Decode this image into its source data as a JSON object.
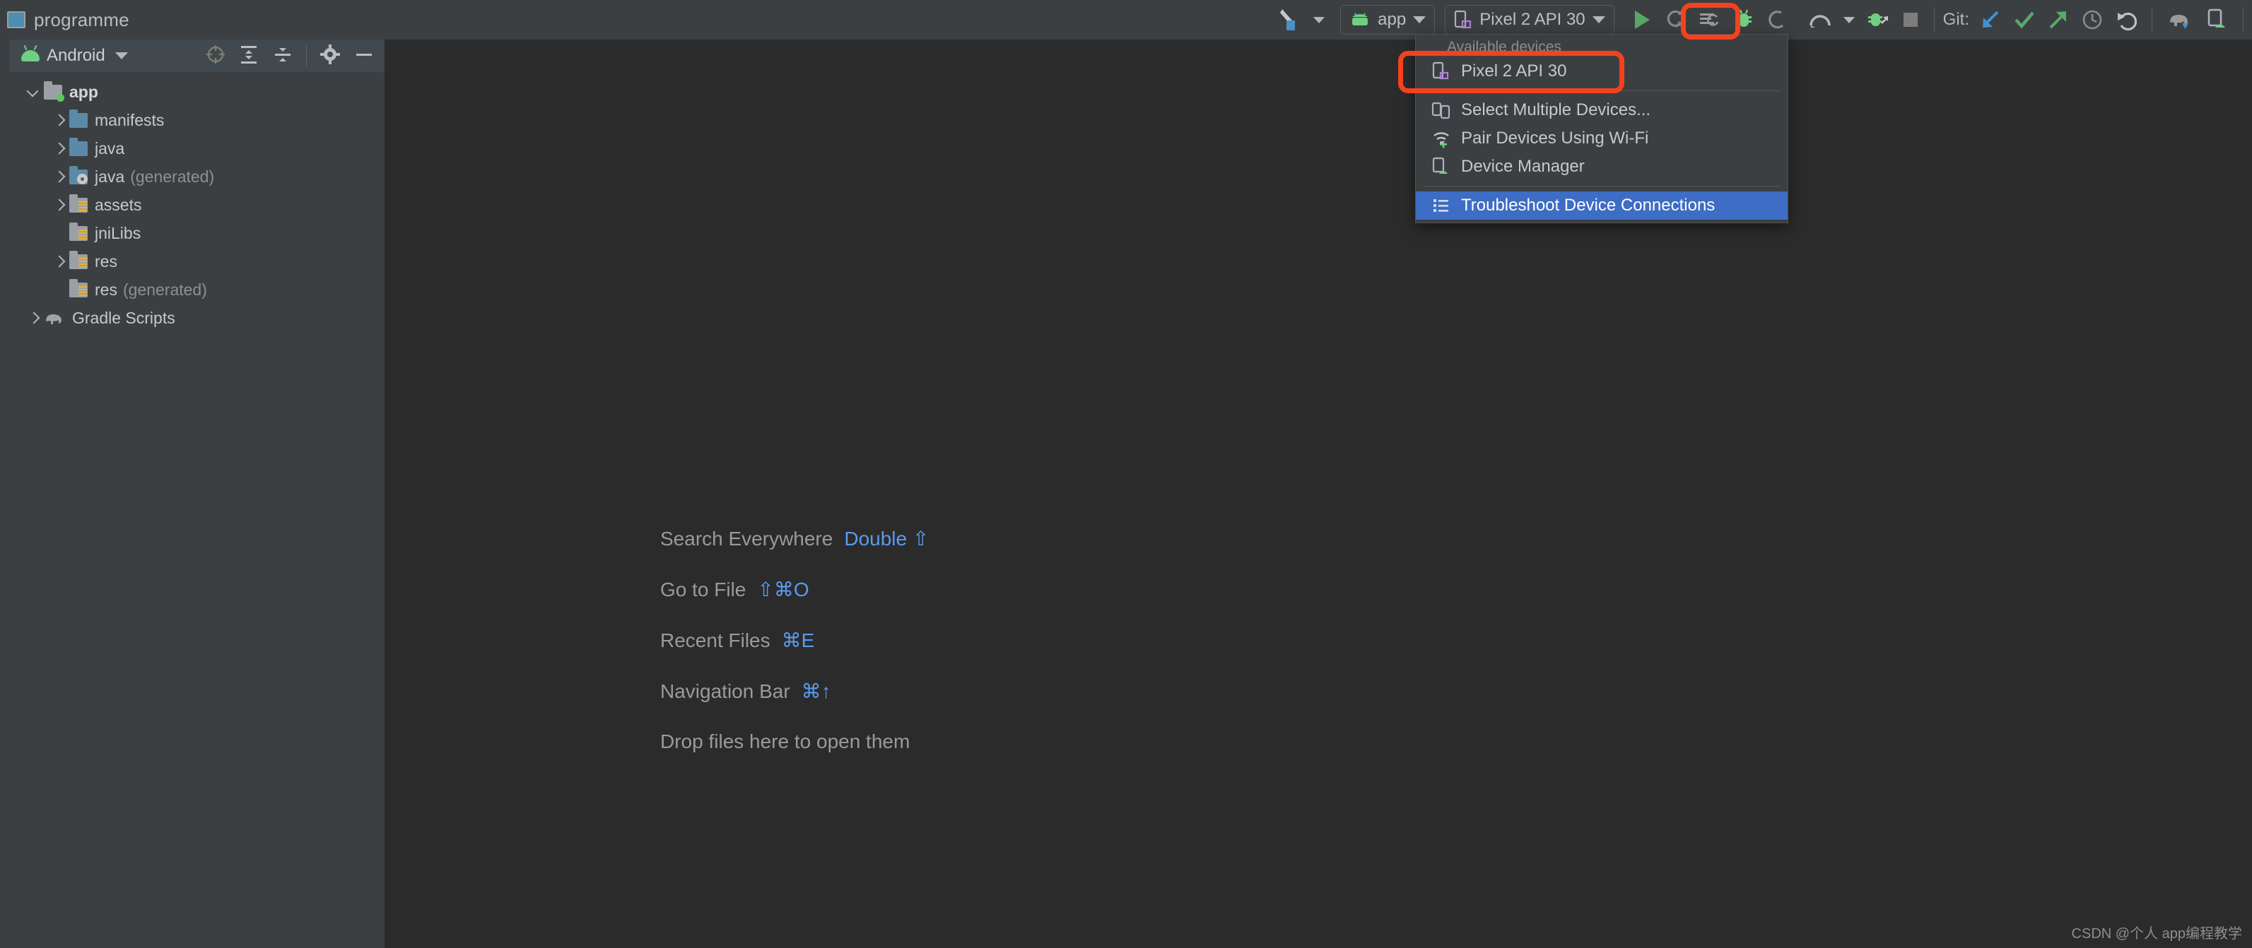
{
  "window": {
    "project_name": "programme",
    "project_icon": "project-square-icon"
  },
  "toolbar": {
    "build_variant_icon": "hammer-icon",
    "run_config": {
      "label": "app",
      "icon": "android-head-icon"
    },
    "device_target": {
      "label": "Pixel 2 API 30",
      "icon": "device-phone-icon"
    },
    "actions": [
      {
        "name": "run-button",
        "icon": "play-icon"
      },
      {
        "name": "apply-changes-button",
        "icon": "apply-changes-icon"
      },
      {
        "name": "apply-code-changes-button",
        "icon": "apply-code-changes-icon"
      },
      {
        "name": "debug-button",
        "icon": "bug-icon"
      },
      {
        "name": "run-with-coverage-button",
        "icon": "coverage-icon"
      },
      {
        "name": "profile-button",
        "icon": "profiler-icon"
      },
      {
        "name": "attach-debugger-button",
        "icon": "attach-debugger-icon"
      },
      {
        "name": "stop-button",
        "icon": "stop-square-icon"
      }
    ],
    "git_label": "Git:",
    "git_actions": [
      {
        "name": "update-project-button",
        "icon": "arrow-down-left-icon"
      },
      {
        "name": "commit-button",
        "icon": "check-icon"
      },
      {
        "name": "push-button",
        "icon": "arrow-up-right-icon"
      },
      {
        "name": "history-button",
        "icon": "clock-icon"
      },
      {
        "name": "rollback-button",
        "icon": "undo-icon"
      }
    ],
    "right_actions": [
      {
        "name": "gradle-sync-button",
        "icon": "elephant-sync-icon"
      },
      {
        "name": "avd-manager-button",
        "icon": "device-android-icon"
      }
    ]
  },
  "project_panel": {
    "title": "Android",
    "title_icon": "android-head-icon",
    "header_actions": [
      {
        "name": "select-opened-file-button",
        "icon": "crosshair-icon"
      },
      {
        "name": "expand-all-button",
        "icon": "expand-all-icon"
      },
      {
        "name": "collapse-all-button",
        "icon": "collapse-all-icon"
      },
      {
        "name": "settings-button",
        "icon": "gear-icon"
      },
      {
        "name": "hide-panel-button",
        "icon": "minimize-icon"
      }
    ],
    "tree": [
      {
        "label": "app",
        "suffix": "",
        "indent": 0,
        "arrow": "open",
        "icon": "module-folder-icon",
        "bold": true
      },
      {
        "label": "manifests",
        "suffix": "",
        "indent": 1,
        "arrow": "closed",
        "icon": "blue-folder-icon",
        "bold": false
      },
      {
        "label": "java",
        "suffix": "",
        "indent": 1,
        "arrow": "closed",
        "icon": "blue-folder-icon",
        "bold": false
      },
      {
        "label": "java",
        "suffix": "(generated)",
        "indent": 1,
        "arrow": "closed",
        "icon": "blue-folder-generated-icon",
        "bold": false
      },
      {
        "label": "assets",
        "suffix": "",
        "indent": 1,
        "arrow": "closed",
        "icon": "grey-folder-icon",
        "bold": false
      },
      {
        "label": "jniLibs",
        "suffix": "",
        "indent": 1,
        "arrow": "none",
        "icon": "grey-folder-icon",
        "bold": false
      },
      {
        "label": "res",
        "suffix": "",
        "indent": 1,
        "arrow": "closed",
        "icon": "grey-folder-icon",
        "bold": false
      },
      {
        "label": "res",
        "suffix": "(generated)",
        "indent": 1,
        "arrow": "none",
        "icon": "grey-folder-icon",
        "bold": false
      },
      {
        "label": "Gradle Scripts",
        "suffix": "",
        "indent": 0,
        "arrow": "closed",
        "icon": "elephant-icon",
        "bold": false
      }
    ]
  },
  "editor": {
    "hints": [
      {
        "name": "Search Everywhere",
        "key": "Double ⇧"
      },
      {
        "name": "Go to File",
        "key": "⇧⌘O"
      },
      {
        "name": "Recent Files",
        "key": "⌘E"
      },
      {
        "name": "Navigation Bar",
        "key": "⌘↑"
      }
    ],
    "drop_text": "Drop files here to open them"
  },
  "device_menu": {
    "caption": "Available devices",
    "items": [
      {
        "label": "Pixel 2 API 30",
        "icon": "device-phone-icon",
        "selected": false,
        "separator_after": true
      },
      {
        "label": "Select Multiple Devices...",
        "icon": "multiple-devices-icon",
        "selected": false,
        "separator_after": false
      },
      {
        "label": "Pair Devices Using Wi-Fi",
        "icon": "wifi-plus-icon",
        "selected": false,
        "separator_after": false
      },
      {
        "label": "Device Manager",
        "icon": "device-android-icon",
        "selected": false,
        "separator_after": true
      },
      {
        "label": "Troubleshoot Device Connections",
        "icon": "list-icon",
        "selected": true,
        "separator_after": false
      }
    ]
  },
  "annotations": {
    "highlight_color": "#f4411e",
    "boxes": [
      {
        "name": "device-item-highlight"
      },
      {
        "name": "debug-button-highlight"
      }
    ]
  },
  "watermark": "CSDN @个人 app编程教学",
  "colors": {
    "toolbar_bg": "#3c3f41",
    "editor_bg": "#2b2b2b",
    "panel_header_bg": "#41494f",
    "menu_selected_bg": "#3d6dc4",
    "accent_blue": "#5a9bf0",
    "android_green": "#6fcf82"
  }
}
